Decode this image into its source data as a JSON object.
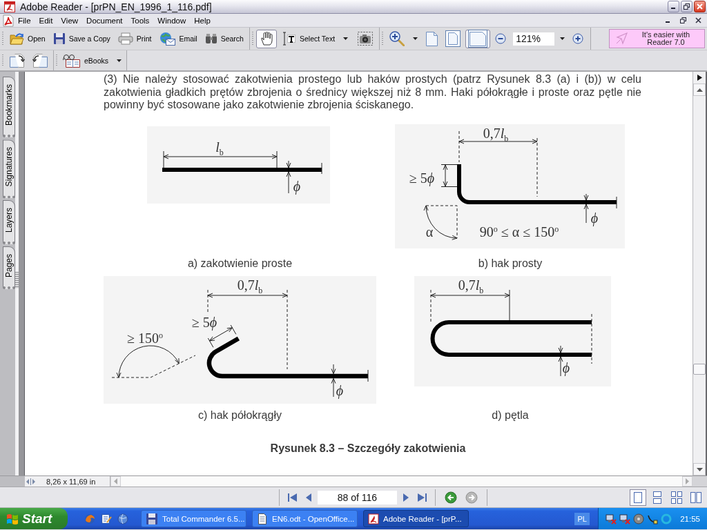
{
  "window": {
    "title": "Adobe Reader - [prPN_EN_1996_1_116.pdf]"
  },
  "menu": {
    "items": [
      "File",
      "Edit",
      "View",
      "Document",
      "Tools",
      "Window",
      "Help"
    ]
  },
  "toolbar": {
    "file_buttons": [
      {
        "kind": "open",
        "label": "Open"
      },
      {
        "kind": "save",
        "label": "Save a Copy"
      },
      {
        "kind": "print",
        "label": "Print"
      },
      {
        "kind": "email",
        "label": "Email"
      },
      {
        "kind": "search",
        "label": "Search"
      }
    ],
    "tools": [
      {
        "kind": "hand",
        "selected": true
      },
      {
        "kind": "select-text",
        "label": "Select Text",
        "selected": false
      },
      {
        "kind": "snapshot",
        "selected": false
      }
    ],
    "page_views": [
      {
        "kind": "actual-size",
        "selected": false
      },
      {
        "kind": "fit-page",
        "selected": false
      },
      {
        "kind": "fit-width",
        "selected": true
      }
    ],
    "zoom": "121%",
    "promo": "It's easier with Reader 7.0"
  },
  "toolbar_2": {
    "ebooks": "eBooks"
  },
  "nav_tabs": [
    {
      "label": "Bookmarks",
      "selected": false
    },
    {
      "label": "Signatures",
      "selected": false
    },
    {
      "label": "Layers",
      "selected": false
    },
    {
      "label": "Pages",
      "selected": false
    }
  ],
  "document": {
    "paragraph": "(3) Nie należy stosować zakotwienia prostego lub haków prostych (patrz Rysunek 8.3 (a) i (b)) w celu zakotwienia gładkich prętów zbrojenia o średnicy większej niż 8 mm. Haki półokrągłe i proste oraz pętle nie powinny być stosowane jako zakotwienie zbrojenia ściskanego.",
    "figures": [
      {
        "kind": "straight",
        "caption": "a) zakotwienie proste",
        "labels": [
          {
            "kind": "length",
            "text": "*l*$_{b}$"
          },
          {
            "kind": "diameter",
            "text": "ϕ"
          }
        ]
      },
      {
        "kind": "bend",
        "caption": "b) hak prosty",
        "labels": [
          {
            "kind": "length",
            "coefficient": "0,7",
            "text": "*l*$_{b}$"
          },
          {
            "kind": "bend",
            "coefficient": "≥ 5",
            "text": "*ϕ*"
          },
          {
            "kind": "angle",
            "text": "α"
          },
          {
            "kind": "range",
            "text": "90$^{o}$ ≤ α ≤ 150$^{o}$"
          },
          {
            "kind": "diameter",
            "text": "ϕ"
          }
        ]
      },
      {
        "kind": "hook",
        "caption": "c) hak półokrągły",
        "labels": [
          {
            "kind": "length",
            "coefficient": "0,7",
            "text": "*l*$_{b}$"
          },
          {
            "kind": "bend",
            "coefficient": "≥ 5",
            "text": "*ϕ*"
          },
          {
            "kind": "angle",
            "text": "≥ 150$^{o}$"
          },
          {
            "kind": "diameter",
            "text": "ϕ"
          }
        ]
      },
      {
        "kind": "loop",
        "caption": "d) pętla",
        "labels": [
          {
            "kind": "length",
            "coefficient": "0,7",
            "text": "*l*$_{b}$"
          },
          {
            "kind": "diameter",
            "text": "ϕ"
          }
        ]
      }
    ],
    "figure_title": "Rysunek 8.3 – Szczegóły zakotwienia"
  },
  "status": {
    "page_size": "8,26 x 11,69 in"
  },
  "navigation": {
    "page": "88 of 116",
    "layouts": [
      {
        "kind": "single-page",
        "selected": true
      },
      {
        "kind": "continuous",
        "selected": false
      },
      {
        "kind": "continuous-facing",
        "selected": false
      },
      {
        "kind": "facing",
        "selected": false
      }
    ]
  },
  "taskbar": {
    "start": "Start",
    "tasks": [
      {
        "kind": "file-manager",
        "label": "Total Commander 6.5...",
        "selected": false
      },
      {
        "kind": "document",
        "label": "EN6.odt - OpenOffice...",
        "selected": false
      },
      {
        "kind": "pdf",
        "label": "Adobe Reader - [prP...",
        "selected": true
      }
    ],
    "language": "PL",
    "clock": "21:55"
  }
}
